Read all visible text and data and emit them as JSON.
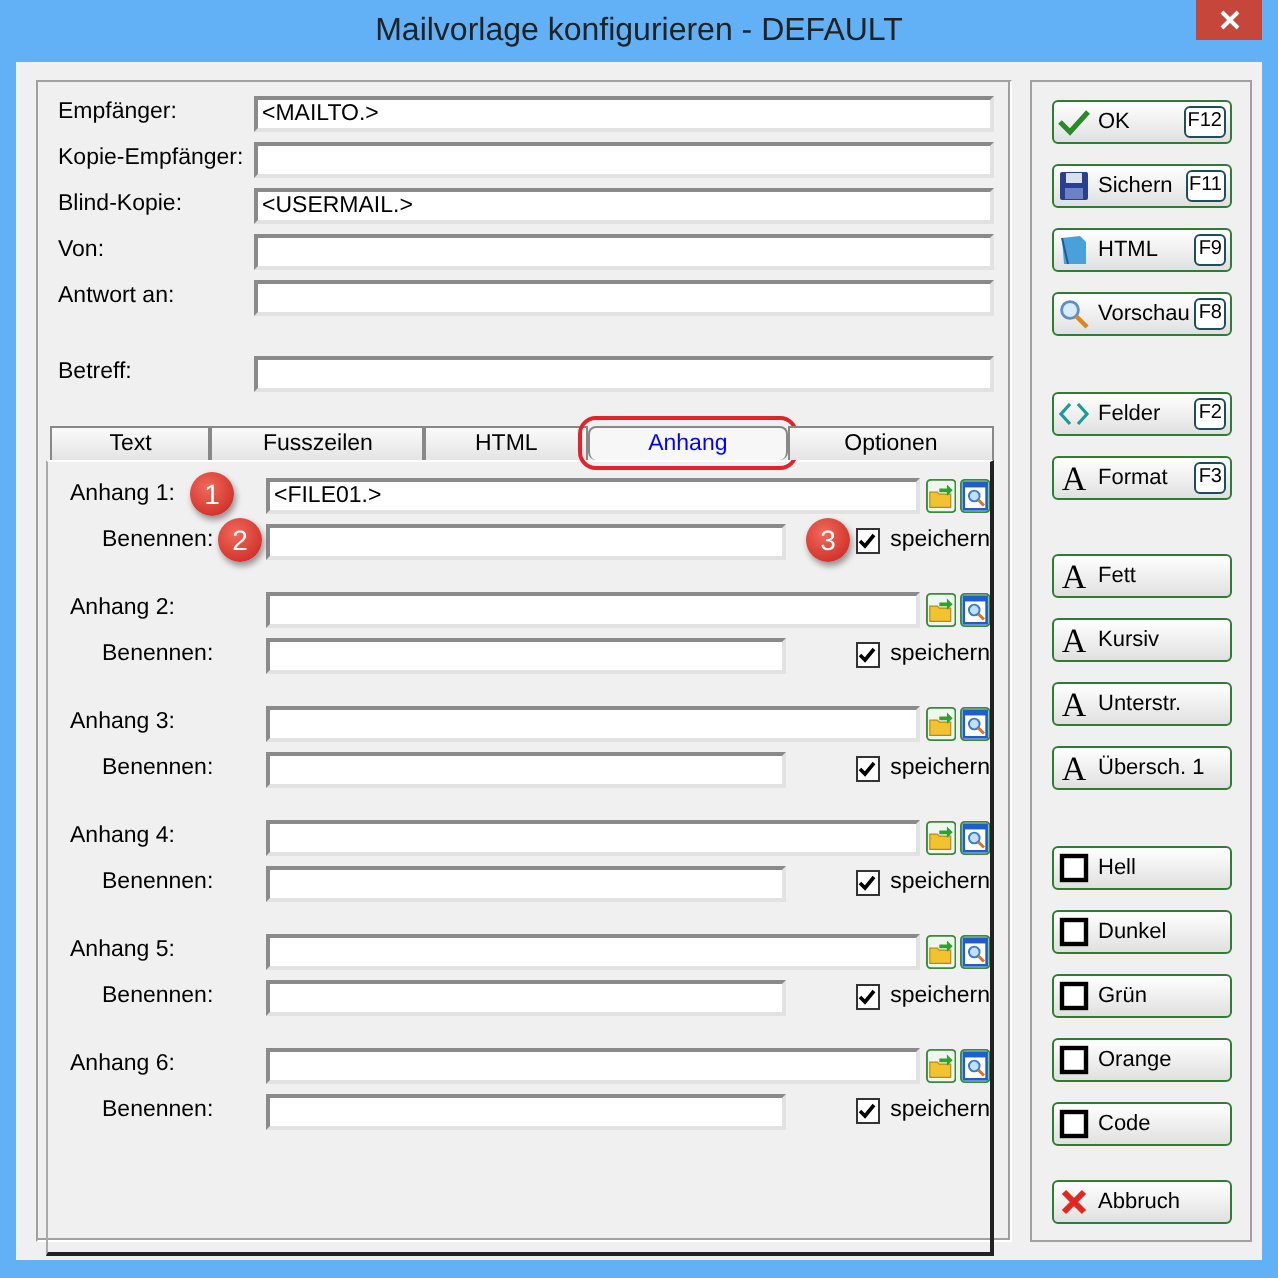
{
  "window": {
    "title": "Mailvorlage konfigurieren - DEFAULT"
  },
  "header_fields": [
    {
      "label": "Empfänger:",
      "value": "<MAILTO.>"
    },
    {
      "label": "Kopie-Empfänger:"
    },
    {
      "label": "Blind-Kopie:",
      "value": "<USERMAIL.>"
    },
    {
      "label": "Von:"
    },
    {
      "label": "Antwort an:"
    },
    {
      "label": "Betreff:",
      "spaced": true
    }
  ],
  "tabs": [
    {
      "label": "Text",
      "selected": false,
      "highlighted": false
    },
    {
      "label": "Fusszeilen",
      "selected": false,
      "highlighted": false
    },
    {
      "label": "HTML",
      "selected": false,
      "highlighted": false
    },
    {
      "label": "Anhang",
      "selected": true,
      "highlighted": true
    },
    {
      "label": "Optionen",
      "selected": false,
      "highlighted": false
    }
  ],
  "attachments": [
    {
      "label": "Anhang 1:",
      "value": "<FILE01.>",
      "name_label": "Benennen:",
      "save_label": "speichern",
      "save_checked": true,
      "callout_file": "1",
      "callout_name": "2",
      "callout_save": "3"
    },
    {
      "label": "Anhang 2:",
      "name_label": "Benennen:",
      "save_label": "speichern",
      "save_checked": true
    },
    {
      "label": "Anhang 3:",
      "name_label": "Benennen:",
      "save_label": "speichern",
      "save_checked": true
    },
    {
      "label": "Anhang 4:",
      "name_label": "Benennen:",
      "save_label": "speichern",
      "save_checked": true
    },
    {
      "label": "Anhang 5:",
      "name_label": "Benennen:",
      "save_label": "speichern",
      "save_checked": true
    },
    {
      "label": "Anhang 6:",
      "name_label": "Benennen:",
      "save_label": "speichern",
      "save_checked": true
    }
  ],
  "button_groups": [
    [
      {
        "label": "OK",
        "hotkey": "F12",
        "kind": "check"
      },
      {
        "label": "Sichern",
        "hotkey": "F11",
        "kind": "disk"
      },
      {
        "label": "HTML",
        "hotkey": "F9",
        "kind": "page"
      },
      {
        "label": "Vorschau",
        "hotkey": "F8",
        "kind": "magnifier"
      }
    ],
    [
      {
        "label": "Felder",
        "hotkey": "F2",
        "kind": "brackets"
      },
      {
        "label": "Format",
        "hotkey": "F3",
        "kind": "glyph",
        "glyph": "A"
      }
    ],
    [
      {
        "label": "Fett",
        "kind": "glyph",
        "glyph": "A"
      },
      {
        "label": "Kursiv",
        "kind": "glyph",
        "glyph": "A"
      },
      {
        "label": "Unterstr.",
        "kind": "glyph",
        "glyph": "A"
      },
      {
        "label": "Übersch. 1",
        "kind": "glyph",
        "glyph": "A"
      }
    ],
    [
      {
        "label": "Hell",
        "kind": "square"
      },
      {
        "label": "Dunkel",
        "kind": "square"
      },
      {
        "label": "Grün",
        "kind": "square"
      },
      {
        "label": "Orange",
        "kind": "square"
      },
      {
        "label": "Code",
        "kind": "square"
      }
    ],
    [
      {
        "label": "Abbruch",
        "kind": "cross"
      }
    ]
  ]
}
